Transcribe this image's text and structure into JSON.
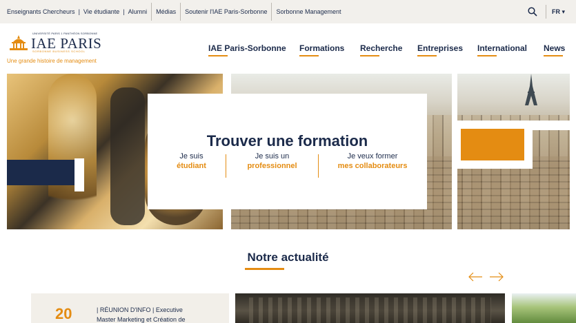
{
  "utility": {
    "links": [
      "Enseignants Chercheurs",
      "Vie étudiante",
      "Alumni",
      "Médias",
      "Soutenir l'IAE Paris-Sorbonne",
      "Sorbonne Management"
    ],
    "separator": "|",
    "lang": "FR ▾"
  },
  "logo": {
    "small": "UNIVERSITÉ PARIS 1 PANTHÉON SORBONNE",
    "main": "IAE PARIS",
    "sub": "SORBONNE BUSINESS SCHOOL",
    "tagline": "Une grande histoire de management"
  },
  "nav": [
    "IAE Paris-Sorbonne",
    "Formations",
    "Recherche",
    "Entreprises",
    "International",
    "News"
  ],
  "formation": {
    "title": "Trouver une formation",
    "choices": [
      {
        "top": "Je suis",
        "bottom": "étudiant"
      },
      {
        "top": "Je suis un",
        "bottom": "professionnel"
      },
      {
        "top": "Je veux former",
        "bottom": "mes collaborateurs"
      }
    ]
  },
  "news": {
    "title": "Notre actualité",
    "card": {
      "day": "20",
      "line1": "| RÉUNION D'INFO | Executive",
      "line2": "Master Marketing et Création de"
    }
  },
  "colors": {
    "navy": "#1b2a4a",
    "orange": "#e48c12",
    "beige": "#f2f0ec"
  },
  "icons": [
    "search-icon",
    "arrow-left-icon",
    "arrow-right-icon",
    "pantheon-logo-icon"
  ]
}
